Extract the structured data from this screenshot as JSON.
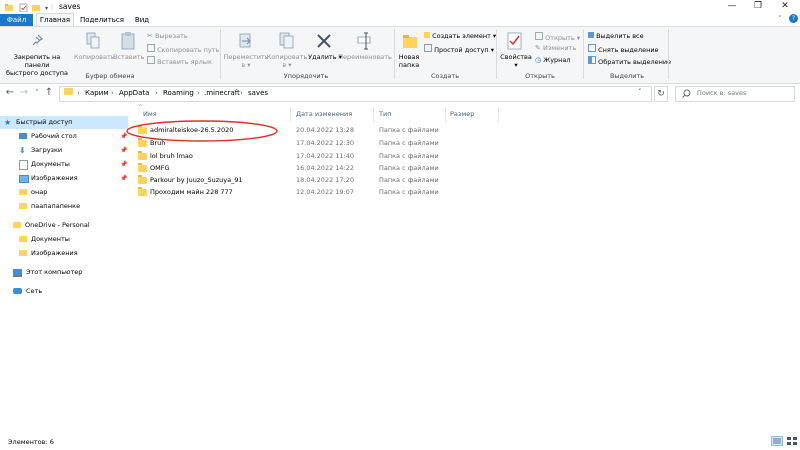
{
  "window": {
    "title": "saves",
    "minimize": "—",
    "maximize": "❐",
    "close": "✕"
  },
  "tabs": [
    "Файл",
    "Главная",
    "Поделиться",
    "Вид"
  ],
  "ribbon": {
    "clipboard": {
      "pin_quick_line1": "Закрепить на панели",
      "pin_quick_line2": "быстрого доступа",
      "copy": "Копировать",
      "paste": "Вставить",
      "cut": "Вырезать",
      "copy_path": "Скопировать путь",
      "paste_shortcut": "Вставить ярлык",
      "group": "Буфер обмена"
    },
    "organize": {
      "move_line1": "Переместить",
      "move_line2": "в ▾",
      "copy_line1": "Копировать",
      "copy_line2": "в ▾",
      "delete": "Удалить ▾",
      "rename": "Переименовать",
      "group": "Упорядочить"
    },
    "create": {
      "new_folder_line1": "Новая",
      "new_folder_line2": "папка",
      "new_item": "Создать элемент ▾",
      "easy_access": "Простой доступ ▾",
      "group": "Создать"
    },
    "open": {
      "properties": "Свойства",
      "properties_arrow": "▾",
      "open": "Открыть ▾",
      "edit": "Изменить",
      "history": "Журнал",
      "group": "Открыть"
    },
    "select": {
      "select_all": "Выделить все",
      "select_none": "Снять выделение",
      "invert": "Обратить выделение",
      "group": "Выделить"
    }
  },
  "address": {
    "breadcrumbs": [
      "Карим",
      "AppData",
      "Roaming",
      ".minecraft",
      "saves"
    ],
    "search_placeholder": "Поиск в: saves"
  },
  "nav_pane": {
    "quick_access": "Быстрый доступ",
    "items": [
      "Рабочий стол",
      "Загрузки",
      "Документы",
      "Изображения",
      "онар",
      "паапапапенке"
    ],
    "onedrive": "OneDrive - Personal",
    "onedrive_items": [
      "Документы",
      "Изображения"
    ],
    "this_pc": "Этот компьютер",
    "network": "Сеть"
  },
  "columns": {
    "name": "Имя",
    "date": "Дата изменения",
    "type": "Тип",
    "size": "Размер"
  },
  "files": [
    {
      "name": "admiralteiskoe-26.5.2020",
      "date": "20.04.2022 13:28",
      "type": "Папка с файлами"
    },
    {
      "name": "Bruh",
      "date": "17.04.2022 12:30",
      "type": "Папка с файлами"
    },
    {
      "name": "lol bruh lmao",
      "date": "17.04.2022 11:40",
      "type": "Папка с файлами"
    },
    {
      "name": "OMFG",
      "date": "16.04.2022 14:22",
      "type": "Папка с файлами"
    },
    {
      "name": "Parkour by Juuzo_Suzuya_91",
      "date": "18.04.2022 17:20",
      "type": "Папка с файлами"
    },
    {
      "name": "Проходим майн 228 777",
      "date": "12.04.2022 19:07",
      "type": "Папка с файлами"
    }
  ],
  "status": {
    "count": "Элементов: 6"
  },
  "colors": {
    "accent": "#1979ca",
    "selection": "#cce8ff",
    "folder": "#ffd35c",
    "annotation": "#d9322b"
  }
}
